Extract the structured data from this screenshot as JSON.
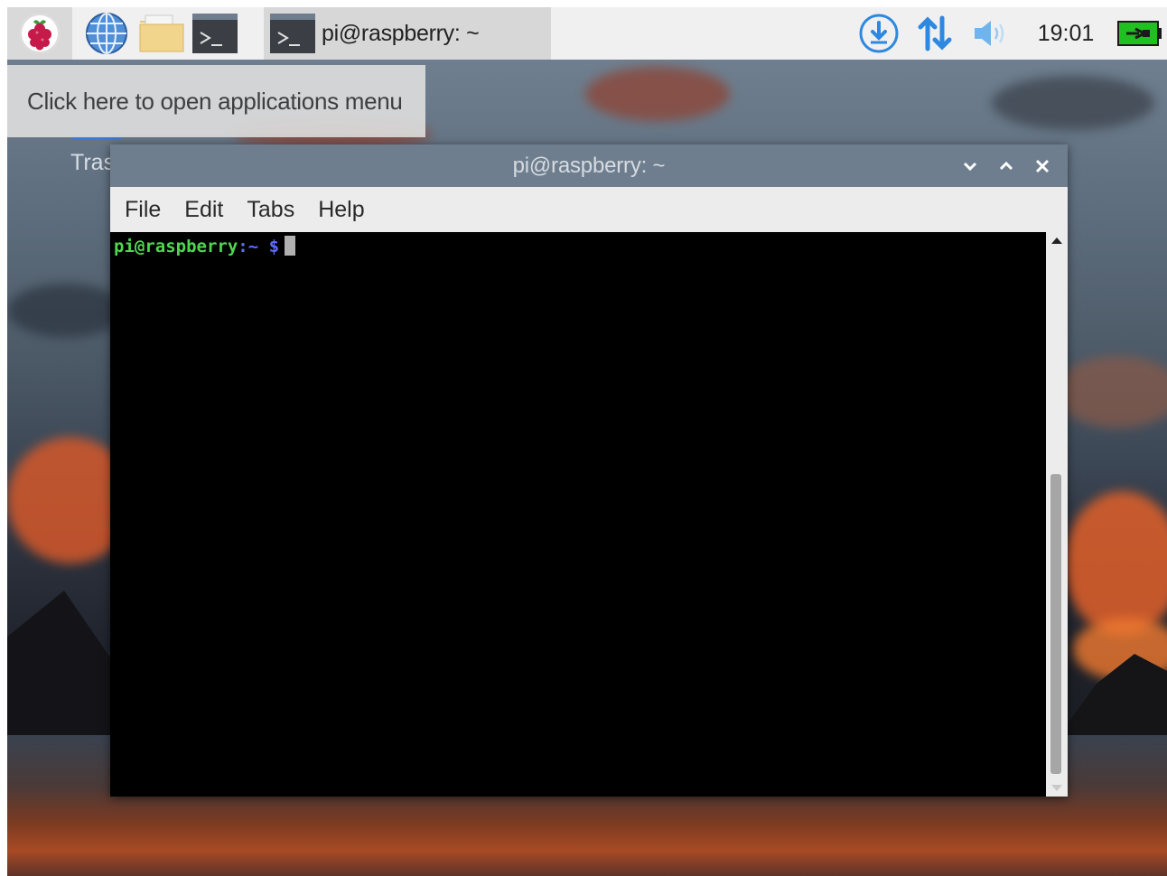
{
  "taskbar": {
    "menu_button_icon": "raspberry-pi-icon",
    "launchers": [
      {
        "icon": "globe-icon"
      },
      {
        "icon": "folder-icon"
      },
      {
        "icon": "terminal-icon"
      }
    ],
    "task_window_label": "pi@raspberry: ~",
    "tray": {
      "updater_icon": "download-icon",
      "network_icon": "network-arrows-icon",
      "volume_icon": "speaker-icon",
      "clock": "19:01",
      "battery_icon": "battery-charging-icon"
    }
  },
  "tooltip": {
    "text": "Click here to open applications menu"
  },
  "desktop": {
    "trash_label": "Tras"
  },
  "terminal_window": {
    "title": "pi@raspberry: ~",
    "menu": [
      "File",
      "Edit",
      "Tabs",
      "Help"
    ],
    "prompt_user": "pi@raspberry",
    "prompt_path": ":~ $"
  },
  "colors": {
    "prompt_user": "#4fd64f",
    "prompt_path": "#5b6cff",
    "titlebar": "#6f7e8e",
    "taskbar": "#f0f0f0"
  }
}
